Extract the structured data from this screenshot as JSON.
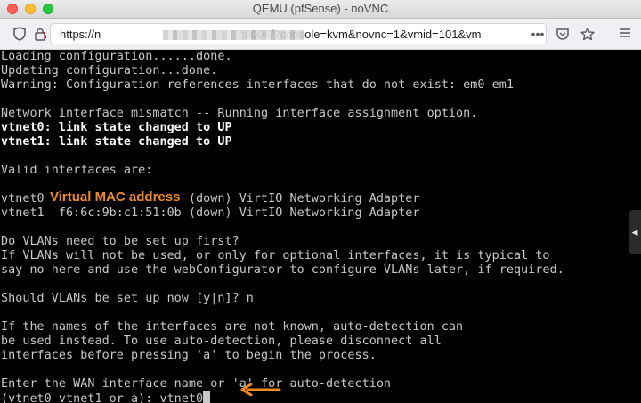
{
  "window": {
    "title": "QEMU (pfSense) - noVNC"
  },
  "browser": {
    "url_prefix": "https://n",
    "url_suffix": ":8006/?console=kvm&novnc=1&vmid=101&vm",
    "icons": [
      "shield-icon",
      "lock-icon",
      "more-icon",
      "pocket-icon",
      "bookmark-star-icon",
      "menu-icon"
    ]
  },
  "console": {
    "lines": [
      {
        "text": "Loading configuration......done.",
        "bright": false
      },
      {
        "text": "Updating configuration...done.",
        "bright": false
      },
      {
        "text": "Warning: Configuration references interfaces that do not exist: em0 em1",
        "bright": false
      },
      {
        "text": "",
        "bright": false
      },
      {
        "text": "Network interface mismatch -- Running interface assignment option.",
        "bright": false
      },
      {
        "text": "vtnet0: link state changed to UP",
        "bright": true
      },
      {
        "text": "vtnet1: link state changed to UP",
        "bright": true
      },
      {
        "text": "",
        "bright": false
      },
      {
        "text": "Valid interfaces are:",
        "bright": false
      },
      {
        "text": "",
        "bright": false
      },
      {
        "text": "vtnet0                    (down) VirtIO Networking Adapter",
        "bright": false
      },
      {
        "text": "vtnet1  f6:6c:9b:c1:51:0b (down) VirtIO Networking Adapter",
        "bright": false
      },
      {
        "text": "",
        "bright": false
      },
      {
        "text": "Do VLANs need to be set up first?",
        "bright": false
      },
      {
        "text": "If VLANs will not be used, or only for optional interfaces, it is typical to",
        "bright": false
      },
      {
        "text": "say no here and use the webConfigurator to configure VLANs later, if required.",
        "bright": false
      },
      {
        "text": "",
        "bright": false
      },
      {
        "text": "Should VLANs be set up now [y|n]? n",
        "bright": false
      },
      {
        "text": "",
        "bright": false
      },
      {
        "text": "If the names of the interfaces are not known, auto-detection can",
        "bright": false
      },
      {
        "text": "be used instead. To use auto-detection, please disconnect all",
        "bright": false
      },
      {
        "text": "interfaces before pressing 'a' to begin the process.",
        "bright": false
      },
      {
        "text": "",
        "bright": false
      },
      {
        "text": "Enter the WAN interface name or 'a' for auto-detection",
        "bright": false
      },
      {
        "text": "(vtnet0 vtnet1 or a): vtnet0",
        "bright": false
      }
    ],
    "annotation": "Virtual MAC address",
    "annotation_color": "#f08a24",
    "side_tab_glyph": "◀"
  }
}
